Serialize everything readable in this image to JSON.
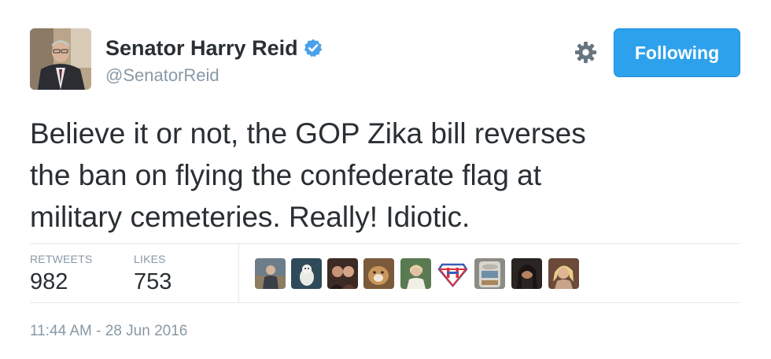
{
  "user": {
    "display_name": "Senator Harry Reid",
    "handle": "@SenatorReid",
    "verified_icon": "verified-badge-icon",
    "accent": "#2ea1ec"
  },
  "actions": {
    "settings_icon": "gear-icon",
    "follow_label": "Following"
  },
  "tweet": {
    "lines": [
      "Believe it or not, the GOP Zika bill reverses",
      "the ban on flying the confederate flag at",
      "military cemeteries. Really! Idiotic."
    ]
  },
  "stats": {
    "retweets_label": "RETWEETS",
    "retweets_value": "982",
    "likes_label": "LIKES",
    "likes_value": "753"
  },
  "likers": [
    "liker-avatar-1",
    "liker-avatar-2",
    "liker-avatar-3",
    "liker-avatar-4",
    "liker-avatar-5",
    "liker-avatar-6",
    "liker-avatar-7",
    "liker-avatar-8",
    "liker-avatar-9"
  ],
  "timestamp": "11:44 AM - 28 Jun 2016"
}
